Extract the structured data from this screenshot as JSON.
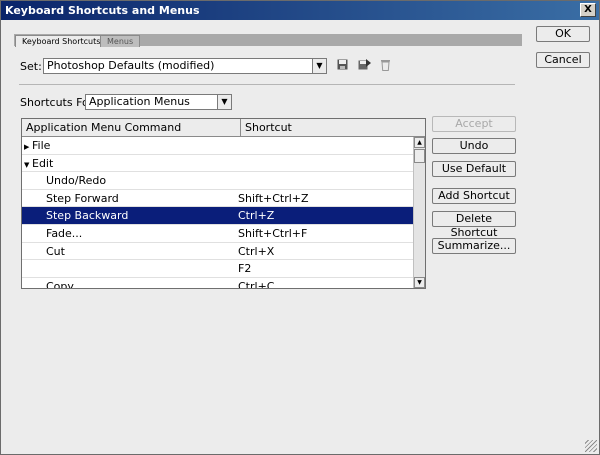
{
  "window": {
    "title": "Keyboard Shortcuts and Menus",
    "close_glyph": "X"
  },
  "tabs": [
    {
      "label": "Keyboard Shortcuts",
      "active": true
    },
    {
      "label": "Menus",
      "active": false
    }
  ],
  "set": {
    "label": "Set:",
    "value": "Photoshop Defaults (modified)",
    "icons": [
      "save-set-icon",
      "save-set-as-icon",
      "delete-set-icon"
    ]
  },
  "shortcuts_for": {
    "label": "Shortcuts For:",
    "value": "Application Menus"
  },
  "table": {
    "columns": [
      "Application Menu Command",
      "Shortcut"
    ],
    "rows": [
      {
        "type": "group",
        "expanded": false,
        "command": "File",
        "shortcut": ""
      },
      {
        "type": "group",
        "expanded": true,
        "command": "Edit",
        "shortcut": ""
      },
      {
        "type": "child",
        "command": "Undo/Redo",
        "shortcut": ""
      },
      {
        "type": "child",
        "command": "Step Forward",
        "shortcut": "Shift+Ctrl+Z"
      },
      {
        "type": "child",
        "command": "Step Backward",
        "shortcut": "Ctrl+Z",
        "selected": true
      },
      {
        "type": "child",
        "command": "Fade...",
        "shortcut": "Shift+Ctrl+F"
      },
      {
        "type": "child",
        "command": "Cut",
        "shortcut": "Ctrl+X"
      },
      {
        "type": "child",
        "command": "",
        "shortcut": "F2"
      },
      {
        "type": "child",
        "command": "Copy",
        "shortcut": "Ctrl+C"
      }
    ]
  },
  "buttons": {
    "ok": "OK",
    "cancel": "Cancel",
    "accept": "Accept",
    "undo": "Undo",
    "use_default": "Use Default",
    "add_shortcut": "Add Shortcut",
    "delete_shortcut": "Delete Shortcut",
    "summarize": "Summarize..."
  },
  "colors": {
    "title_bar": "#0a246a",
    "selection": "#0a1e7a",
    "dialog_bg": "#ececec"
  }
}
